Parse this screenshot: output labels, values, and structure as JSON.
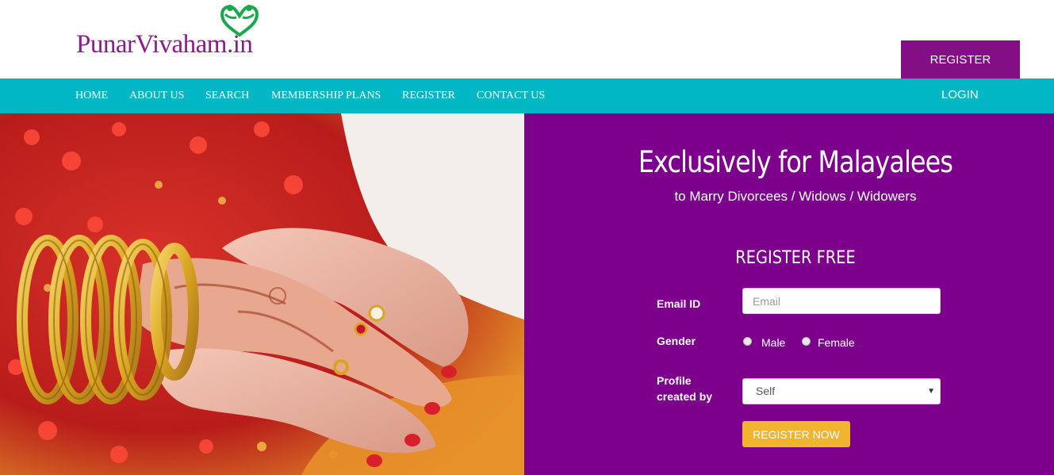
{
  "logo": {
    "text": "PunarVivaham.in",
    "color": "#8b1a8c",
    "icon": "hearts-couple-icon",
    "icon_color": "#1aa84f"
  },
  "header": {
    "register_label": "REGISTER"
  },
  "nav": {
    "items": [
      {
        "label": "HOME"
      },
      {
        "label": "ABOUT US"
      },
      {
        "label": "SEARCH"
      },
      {
        "label": "MEMBERSHIP PLANS"
      },
      {
        "label": "REGISTER"
      },
      {
        "label": "CONTACT US"
      }
    ],
    "login_label": "LOGIN",
    "color": "#00b7c3"
  },
  "hero": {
    "image": "wedding-hands-photo"
  },
  "panel": {
    "title": "Exclusively for Malayalees",
    "subtitle": "to Marry Divorcees / Widows / Widowers",
    "form_title": "REGISTER FREE",
    "email_label": "Email ID",
    "email_placeholder": "Email",
    "email_value": "",
    "gender_label": "Gender",
    "gender_options": [
      "Male",
      "Female"
    ],
    "profile_label_line1": "Profile",
    "profile_label_line2": "created by",
    "profile_selected": "Self",
    "submit_label": "REGISTER NOW",
    "background": "#7c008c",
    "button_color": "#f0b42e"
  }
}
